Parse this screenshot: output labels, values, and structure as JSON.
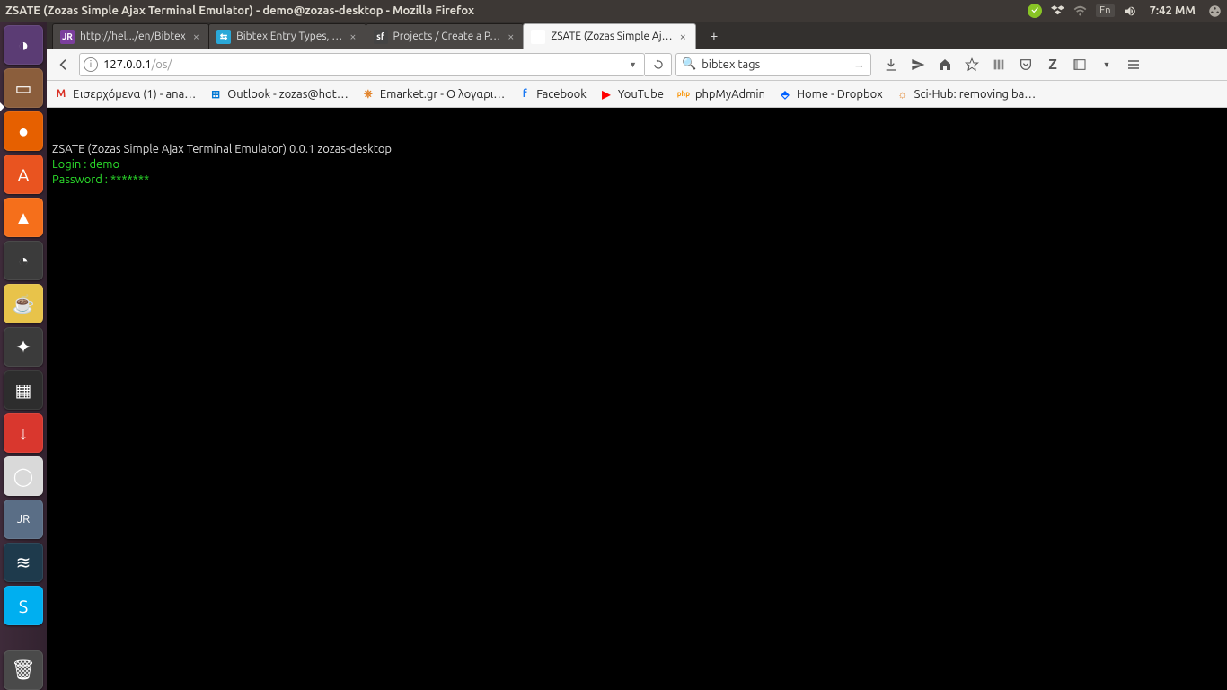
{
  "sysbar": {
    "title": "ZSATE (Zozas Simple Ajax Terminal Emulator) - demo@zozas-desktop - Mozilla Firefox",
    "lang": "En",
    "clock": "7:42 MM"
  },
  "tabs": [
    {
      "label": "http://hel.../en/Bibtex",
      "favbg": "#7b3f9d",
      "favtx": "JR",
      "active": false
    },
    {
      "label": "Bibtex Entry Types, …",
      "favbg": "#2aa8d8",
      "favtx": "⇆",
      "active": false
    },
    {
      "label": "Projects / Create a P…",
      "favbg": "#444",
      "favtx": "sf",
      "active": false
    },
    {
      "label": "ZSATE (Zozas Simple Aj…",
      "favbg": "#fff",
      "favtx": "",
      "active": true
    }
  ],
  "url": {
    "host": "127.0.0.1",
    "path": "/os/"
  },
  "search": {
    "text": "bibtex tags"
  },
  "bookmarks": [
    {
      "label": "Εισερχόμενα (1) - ana…",
      "icon": "M",
      "color": "#d93025"
    },
    {
      "label": "Outlook - zozas@hot…",
      "icon": "⊞",
      "color": "#0078d4"
    },
    {
      "label": "Emarket.gr - Ο λογαρι…",
      "icon": "⎈",
      "color": "#e07b1c"
    },
    {
      "label": "Facebook",
      "icon": "f",
      "color": "#1877f2"
    },
    {
      "label": "YouTube",
      "icon": "▶",
      "color": "#ff0000"
    },
    {
      "label": "phpMyAdmin",
      "icon": "php",
      "color": "#f89406"
    },
    {
      "label": "Home - Dropbox",
      "icon": "⬘",
      "color": "#0061ff"
    },
    {
      "label": "Sci-Hub: removing ba…",
      "icon": "☼",
      "color": "#e07b1c"
    }
  ],
  "terminal": {
    "line1": "ZSATE (Zozas Simple Ajax Terminal Emulator) 0.0.1 zozas-desktop",
    "login_label": "Login : ",
    "login_value": "demo",
    "pass_label": "Password : ",
    "pass_value": "*******"
  },
  "launcher": [
    {
      "bg": "#5b3c74",
      "glyph": "◑"
    },
    {
      "bg": "#8b5e3c",
      "glyph": "▭"
    },
    {
      "bg": "#e66000",
      "glyph": "●"
    },
    {
      "bg": "#e95420",
      "glyph": "A"
    },
    {
      "bg": "#f56f1b",
      "glyph": "▲"
    },
    {
      "bg": "#3b3b3b",
      "glyph": "◔"
    },
    {
      "bg": "#e8c34a",
      "glyph": "☕"
    },
    {
      "bg": "#3b3b3b",
      "glyph": "✦"
    },
    {
      "bg": "#2d2d2d",
      "glyph": "▦"
    },
    {
      "bg": "#d9372e",
      "glyph": "↓"
    },
    {
      "bg": "#d9d9d9",
      "glyph": "◯"
    },
    {
      "bg": "#5a6e86",
      "glyph": "JR"
    },
    {
      "bg": "#1e3a4c",
      "glyph": "≋"
    },
    {
      "bg": "#00aff0",
      "glyph": "S"
    }
  ],
  "trash": {
    "bg": "#4a4a4a",
    "glyph": "🗑"
  }
}
